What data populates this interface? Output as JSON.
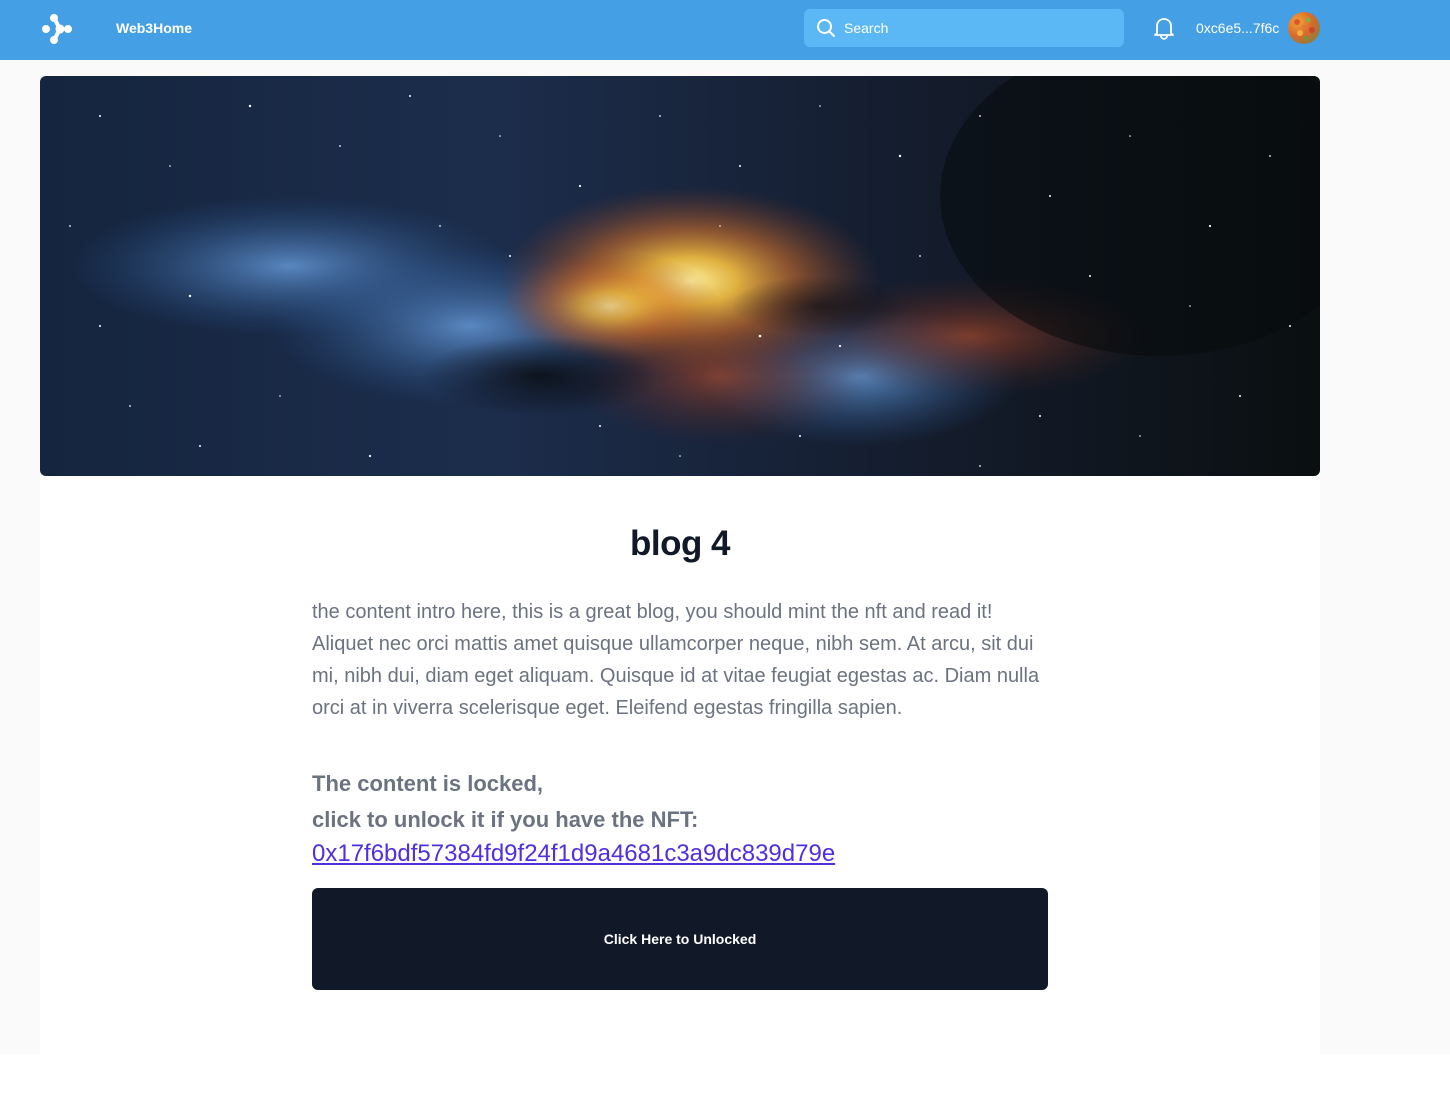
{
  "header": {
    "brand": "Web3Home",
    "search_placeholder": "Search",
    "wallet_address": "0xc6e5...7f6c"
  },
  "post": {
    "title": "blog 4",
    "intro": "the content intro here, this is a great blog, you should mint the nft and read it! Aliquet nec orci mattis amet quisque ullamcorper neque, nibh sem. At arcu, sit dui mi, nibh dui, diam eget aliquam. Quisque id at vitae feugiat egestas ac. Diam nulla orci at in viverra scelerisque eget. Eleifend egestas fringilla sapien.",
    "locked_line1": "The content is locked,",
    "locked_line2": "click to unlock it if you have the NFT:",
    "nft_address": "0x17f6bdf57384fd9f24f1d9a4681c3a9dc839d79e",
    "unlock_button": "Click Here to Unlocked"
  },
  "colors": {
    "header_bg": "#449fe4",
    "button_bg": "#111827",
    "link": "#4f2fe0"
  }
}
